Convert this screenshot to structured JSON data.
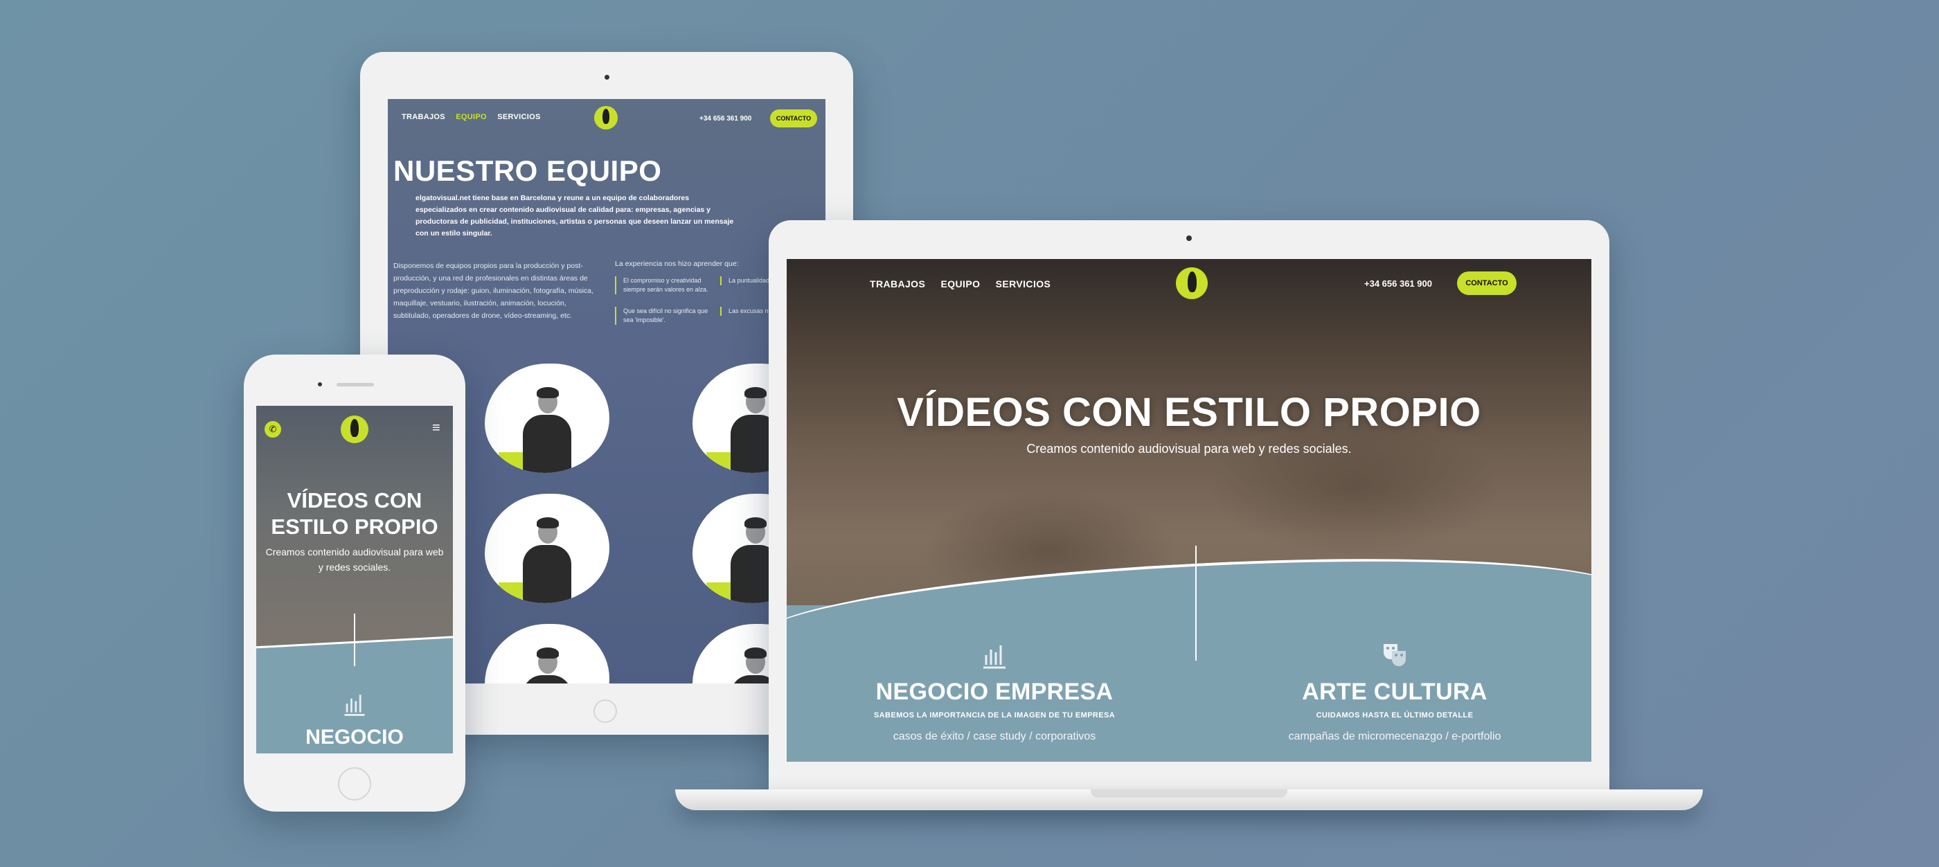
{
  "tablet": {
    "nav": [
      "TRABAJOS",
      "EQUIPO",
      "SERVICIOS"
    ],
    "phone": "+34 656 361 900",
    "contact": "CONTACTO",
    "title": "NUESTRO EQUIPO",
    "intro": "elgatovisual.net tiene base en Barcelona y reune a un equipo de colaboradores especializados en crear contenido audiovisual de calidad para: empresas, agencias y productoras de publicidad, instituciones, artistas o personas que deseen lanzar un mensaje con un estilo singular.",
    "left_text": "Disponemos de equipos propios para la producción y post-producción, y una red de profesionales en distintas áreas de preproducción y rodaje: guion, iluminación, fotografía, música, maquillaje, vestuario, ilustración, animación, locución, subtitulado, operadores de drone, vídeo-streaming, etc.",
    "experience": "La experiencia nos hizo aprender que:",
    "cells": [
      "El compromiso y creatividad siempre serán valores en alza.",
      "La puntualidad de entrega es",
      "Que sea difícil no significa que sea 'imposible'.",
      "Las excusas no grabar."
    ]
  },
  "laptop": {
    "nav": [
      "TRABAJOS",
      "EQUIPO",
      "SERVICIOS"
    ],
    "phone": "+34 656 361 900",
    "contact": "CONTACTO",
    "hero_title": "VÍDEOS CON ESTILO PROPIO",
    "hero_sub": "Creamos contenido audiovisual para web y redes sociales.",
    "columns": [
      {
        "icon": "chart-bars-icon",
        "heading": "NEGOCIO EMPRESA",
        "sub": "SABEMOS LA IMPORTANCIA DE LA IMAGEN DE TU EMPRESA",
        "desc": "casos de éxito / case study / corporativos"
      },
      {
        "icon": "theater-masks-icon",
        "heading": "ARTE CULTURA",
        "sub": "CUIDAMOS HASTA EL ÚLTIMO DETALLE",
        "desc": "campañas de micromecenazgo / e-portfolio"
      }
    ]
  },
  "phone": {
    "hero_title": "VÍDEOS CON ESTILO PROPIO",
    "hero_sub": "Creamos contenido audiovisual para web y redes sociales.",
    "section": "NEGOCIO"
  },
  "colors": {
    "accent": "#c8e02a",
    "background": "#6f8ca3",
    "section": "#7ea1b0"
  }
}
